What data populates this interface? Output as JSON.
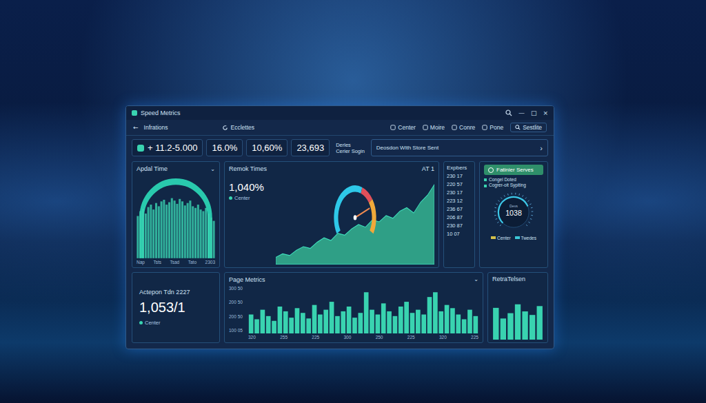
{
  "window": {
    "title": "Speed Metrics",
    "controls": [
      "—",
      "□",
      "×"
    ]
  },
  "toolbar": {
    "back": "←",
    "title": "Infrations",
    "section": "Ecclettes",
    "actions": [
      {
        "label": "Center",
        "kind": "plain"
      },
      {
        "label": "Moire",
        "kind": "plain"
      },
      {
        "label": "Conre",
        "kind": "plain"
      },
      {
        "label": "Pone",
        "kind": "plain"
      },
      {
        "label": "Sestlite",
        "kind": "search"
      }
    ]
  },
  "stats": {
    "items": [
      "+ 11.2-5.000",
      "16.0%",
      "10,60%",
      "23,693"
    ],
    "note": {
      "title": "Derles",
      "subtitle": "Cerier Sogin"
    },
    "action": {
      "label": "Deosdon With Store Sent",
      "chevron": "›"
    }
  },
  "apdal": {
    "title": "Apdal Time",
    "chevron": "⌄",
    "x_labels": [
      "Nap",
      "Tsts",
      "Tsad",
      "Tato",
      "2303"
    ],
    "values": [
      52,
      58,
      61,
      55,
      63,
      66,
      60,
      68,
      64,
      70,
      72,
      66,
      69,
      74,
      71,
      67,
      73,
      70,
      65,
      68,
      71,
      64,
      62,
      66,
      60,
      58,
      62,
      55,
      50,
      46
    ]
  },
  "remok": {
    "title": "Remok Times",
    "badge": "AT 1",
    "big": "1,040%",
    "legend": "Center",
    "gauge": {
      "level": 0.78
    },
    "values": [
      8,
      12,
      10,
      16,
      20,
      18,
      25,
      30,
      27,
      35,
      33,
      40,
      45,
      42,
      50,
      48,
      55,
      52,
      60,
      64,
      58,
      70,
      78,
      90
    ]
  },
  "expbers": {
    "title": "Expbers",
    "values": [
      "230 17",
      "220 57",
      "230 17",
      "223 12",
      "236 67",
      "206 87",
      "230 87",
      "10 07"
    ]
  },
  "status": {
    "button": "Fatinier Serves",
    "lines": [
      "Congel Doted",
      "Cogrer-oit Sypiting"
    ],
    "dial": {
      "label": "Devs",
      "value": "1038",
      "level": 0.75
    },
    "legend": [
      {
        "label": "Center",
        "color": "#d4c04a"
      },
      {
        "label": "Twedes",
        "color": "#3cc8d8"
      }
    ]
  },
  "actepon": {
    "title": "Actepon Tdn 2227",
    "value": "1,053/1",
    "legend": "Center"
  },
  "page_metrics": {
    "title": "Page Metrics",
    "chevron": "⌄",
    "y_ticks": [
      "300 50",
      "200 50",
      "200 50",
      "100 05"
    ],
    "x_labels": [
      "320",
      "255",
      "225",
      "300",
      "250",
      "225",
      "320",
      "225"
    ],
    "values": [
      120,
      90,
      150,
      110,
      80,
      170,
      140,
      100,
      160,
      130,
      95,
      180,
      120,
      150,
      200,
      110,
      140,
      170,
      100,
      130,
      260,
      150,
      120,
      190,
      140,
      110,
      170,
      200,
      130,
      150,
      120,
      230,
      260,
      140,
      180,
      160,
      120,
      90,
      150,
      110
    ]
  },
  "retra": {
    "title": "RetraTelsen",
    "values": [
      180,
      120,
      150,
      200,
      160,
      140,
      190
    ]
  }
}
